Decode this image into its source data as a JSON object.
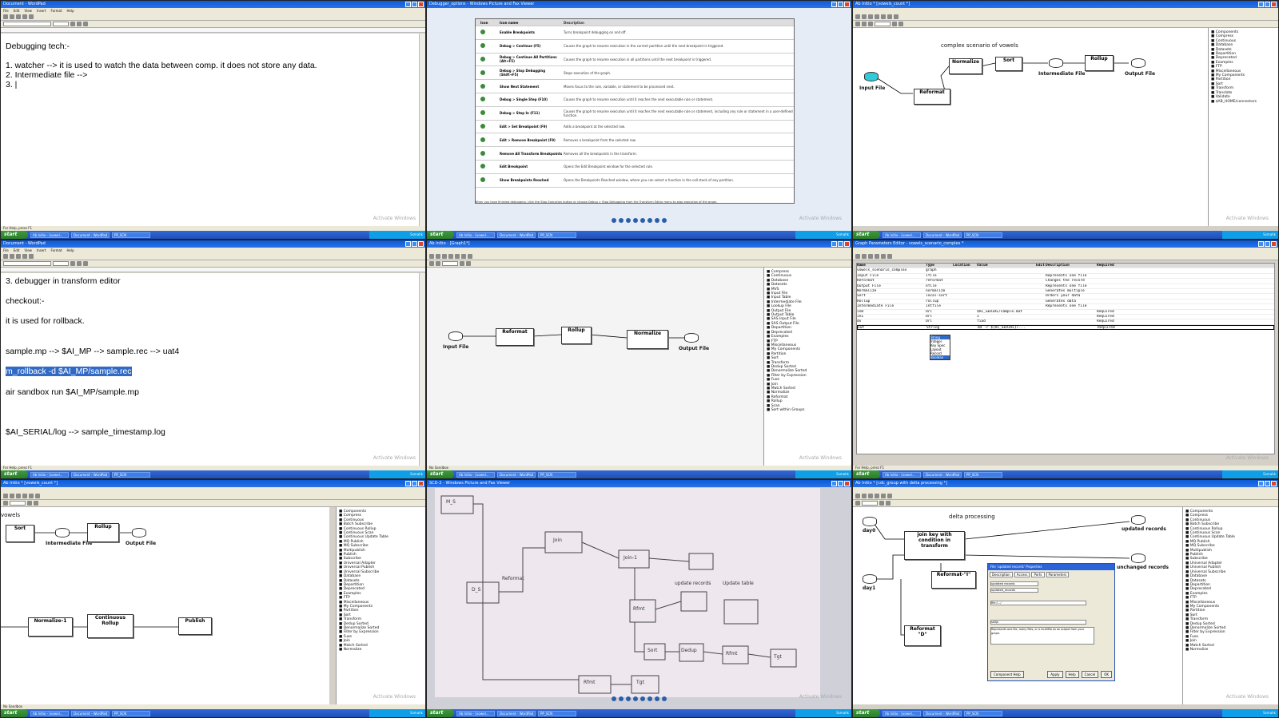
{
  "panes": {
    "p0": {
      "title": "Document - WordPad",
      "menu": [
        "File",
        "Edit",
        "View",
        "Insert",
        "Format",
        "Help"
      ],
      "lines": [
        "Debugging tech:-",
        "",
        "1. watcher --> it is used to watch the data between comp. it does not store any data.",
        "2. Intermediate file -->",
        "3. |"
      ],
      "status": "For Help, press F1",
      "watermark": "Activate Windows"
    },
    "p1": {
      "title": "Debugger_options - Windows Picture and Fax Viewer",
      "headers": [
        "Icon",
        "Icon name",
        "Description"
      ],
      "rows": [
        {
          "name": "Enable Breakpoints",
          "desc": "Turns breakpoint debugging on and off."
        },
        {
          "name": "Debug > Continue (F5)",
          "desc": "Causes the graph to resume execution in the current partition until the next breakpoint is triggered."
        },
        {
          "name": "Debug > Continue All Partitions (Alt+F5)",
          "desc": "Causes the graph to resume execution in all partitions until the next breakpoint is triggered."
        },
        {
          "name": "Debug > Stop Debugging (Shift+F5)",
          "desc": "Stops execution of the graph."
        },
        {
          "name": "Show Next Statement",
          "desc": "Moves focus to the rule, variable, or statement to be processed next."
        },
        {
          "name": "Debug > Single Step (F10)",
          "desc": "Causes the graph to resume execution until it reaches the next executable rule or statement."
        },
        {
          "name": "Debug > Step In (F11)",
          "desc": "Causes the graph to resume execution until it reaches the next executable rule or statement, including any rule or statement in a user-defined function."
        },
        {
          "name": "Edit > Set Breakpoint (F9)",
          "desc": "Adds a breakpoint at the selected row."
        },
        {
          "name": "Edit > Remove Breakpoint (F9)",
          "desc": "Removes a breakpoint from the selected row."
        },
        {
          "name": "Remove All Transform Breakpoints",
          "desc": "Removes all the breakpoints in the transform."
        },
        {
          "name": "Edit Breakpoint",
          "desc": "Opens the Edit Breakpoint window for the selected rule."
        },
        {
          "name": "Show Breakpoints Reached",
          "desc": "Opens the Breakpoints Reached window, where you can select a function in the call stack of any partition."
        }
      ],
      "footer": "When you have finished debugging, click the Stop Execution button or choose Debug > Stop Debugging from the Transform Editor menu to stop execution of the graph.",
      "watermark": "Activate Windows"
    },
    "p2": {
      "title": "Ab Initio * [vowels_count *]",
      "heading": "complex scenario of vowels",
      "nodes": [
        "Input File",
        "Reformat",
        "Normalize",
        "Sort",
        "Intermediate File",
        "Rollup",
        "Output File"
      ],
      "tree": [
        "Components",
        "Compress",
        "Continuous",
        "Database",
        "Datasets",
        "Departition",
        "Deprecated",
        "Examples",
        "FTP",
        "Miscellaneous",
        "My Components",
        "Partition",
        "Sort",
        "Transform",
        "Translate",
        "Validate",
        "$AB_HOME/connectors"
      ],
      "watermark": "Activate Windows"
    },
    "p3": {
      "title": "Document - WordPad",
      "lines": [
        "3. debugger in transform editor",
        "",
        "checkout:-",
        "",
        "it is used for rollback.",
        "",
        "",
        "sample.mp --> $AI_MP --> sample.rec --> uat4",
        "",
        "m_rollback -d $AI_MP/sample.rec",
        "",
        "air sandbox run $AI_MP/sample.mp",
        "",
        "",
        "",
        "$AI_SERIAL/log --> sample_timestamp.log"
      ],
      "selected_line": 9,
      "status": "For Help, press F1",
      "watermark": "Activate Windows"
    },
    "p4": {
      "title": "Ab Initio - [Graph1*]",
      "nodes": [
        "Input File",
        "Reformat",
        "Rollup",
        "Normalize",
        "Output File"
      ],
      "tree": [
        "Compress",
        "Continuous",
        "Database",
        "Datasets",
        "MVS",
        "Input File",
        "Input Table",
        "Intermediate File",
        "Lookup File",
        "Output File",
        "Output Table",
        "SAS Input File",
        "SAS Output File",
        "Departition",
        "Deprecated",
        "Examples",
        "FTP",
        "Miscellaneous",
        "My Components",
        "Partition",
        "Sort",
        "Transform",
        "Dedup Sorted",
        "Denormalize Sorted",
        "Filter by Expression",
        "Fuse",
        "Join",
        "Match Sorted",
        "Normalize",
        "Reformat",
        "Rollup",
        "Scan",
        "Sort within Groups"
      ],
      "status": "No Sandbox",
      "watermark": "Activate Windows"
    },
    "p5": {
      "title": "Graph Parameters Editor - vowels_scenario_complex *",
      "headers": [
        "Name",
        "Type",
        "Location",
        "Value",
        "Edit",
        "Description",
        "Required"
      ],
      "rows": [
        [
          "vowels_scenario_complex",
          "graph",
          "",
          "",
          "",
          "",
          ""
        ],
        [
          "Input File",
          "ifile",
          "",
          "",
          "",
          "Represents one file",
          ""
        ],
        [
          "Reformat",
          "reformat",
          "",
          "",
          "",
          "Changes the record",
          ""
        ],
        [
          "Output File",
          "ofile",
          "",
          "",
          "",
          "Represents one file",
          ""
        ],
        [
          "Normalize",
          "normalize",
          "",
          "",
          "",
          "Generates multiple",
          ""
        ],
        [
          "Sort",
          "local-sort",
          "",
          "",
          "",
          "Orders your data",
          ""
        ],
        [
          "Rollup",
          "rollup",
          "",
          "",
          "",
          "Generates data",
          ""
        ],
        [
          "Intermediate File",
          "intfile",
          "",
          "",
          "",
          "Represents one file",
          ""
        ],
        [
          "in0",
          "Url",
          "",
          "$AI_SERIAL/sample.dat",
          "",
          "",
          "Required"
        ],
        [
          "in1",
          "Url",
          "",
          "1",
          "",
          "",
          "Required"
        ],
        [
          "dv",
          "Url",
          "",
          "fiad",
          "",
          "",
          "Required"
        ],
        [
          "out",
          "String",
          "",
          "m4 -r ${AI_SERIAL}/...",
          "",
          "",
          "Required"
        ]
      ],
      "dropdown": [
        "String",
        "Integer",
        "Key Spec",
        "Layout",
        "Record",
        "Boolean"
      ],
      "status": "For Help, press F1",
      "watermark": "Activate Windows"
    },
    "p6": {
      "title": "Ab Initio * [vowels_count *]",
      "heading": "vowels",
      "nodes": [
        "Sort",
        "Intermediate File",
        "Rollup",
        "Output File",
        "Normalize-1",
        "Continuous Rollup",
        "Publish"
      ],
      "tree": [
        "Components",
        "Compress",
        "Continuous",
        "Batch Subscribe",
        "Continuous Rollup",
        "Continuous Scan",
        "Continuous Update Table",
        "MQ Publish",
        "MQ Subscribe",
        "Multipublish",
        "Publish",
        "Subscribe",
        "Universal Adapter",
        "Universal Publish",
        "Universal Subscribe",
        "Database",
        "Datasets",
        "Departition",
        "Deprecated",
        "Examples",
        "FTP",
        "Miscellaneous",
        "My Components",
        "Partition",
        "Sort",
        "Transform",
        "Dedup Sorted",
        "Denormalize Sorted",
        "Filter by Expression",
        "Fuse",
        "Join",
        "Match Sorted",
        "Normalize"
      ],
      "status": "No Sandbox",
      "watermark": "Activate Windows"
    },
    "p7": {
      "title": "SCD-2 - Windows Picture and Fax Viewer",
      "notes": [
        "M_S",
        "D_S",
        "Join",
        "Reformat",
        "Join-1",
        "Rfmt",
        "Sort",
        "Dedup",
        "Rfmt",
        "Tgt",
        "Rfmt",
        "Tgt",
        "update records",
        "Update table"
      ],
      "watermark": "Activate Windows"
    },
    "p8": {
      "title": "Ab Initio * [cdc_group with delta processing *]",
      "heading": "delta processing",
      "nodes": [
        "day0",
        "join key with condition in transform",
        "updated records",
        "unchanged records",
        "day1",
        "Reformat-\"I\"",
        "Reformat \"D\""
      ],
      "dialog": {
        "title": "File 'updated records' Properties",
        "tabs": [
          "Description",
          "Access",
          "Ports",
          "Parameters"
        ],
        "label_field": "updated records",
        "name_field": "updated_records",
        "url": "file:/.../",
        "author": "sk0jk",
        "comment": "Represents one file, many files, or a multifile as an output from your graph.",
        "buttons": [
          "Component Help",
          "Apply",
          "Help",
          "Cancel",
          "OK"
        ]
      },
      "tree": [
        "Components",
        "Compress",
        "Continuous",
        "Batch Subscribe",
        "Continuous Rollup",
        "Continuous Scan",
        "Continuous Update Table",
        "MQ Publish",
        "MQ Subscribe",
        "Multipublish",
        "Publish",
        "Subscribe",
        "Universal Adapter",
        "Universal Publish",
        "Universal Subscribe",
        "Database",
        "Datasets",
        "Departition",
        "Deprecated",
        "Examples",
        "FTP",
        "Miscellaneous",
        "My Components",
        "Partition",
        "Sort",
        "Transform",
        "Dedup Sorted",
        "Denormalize Sorted",
        "Filter by Expression",
        "Fuse",
        "Join",
        "Match Sorted",
        "Normalize"
      ],
      "watermark": "Activate Windows"
    }
  },
  "taskbar": {
    "start": "start",
    "items": [
      "Ab Initio - [vowel...",
      "Document - WordPad",
      "PP_SCN"
    ],
    "tray": "Ssmahk"
  },
  "colors": {
    "xp_blue": "#0a5bd8",
    "selection": "#316ac5",
    "start_green": "#3c9b3c"
  }
}
